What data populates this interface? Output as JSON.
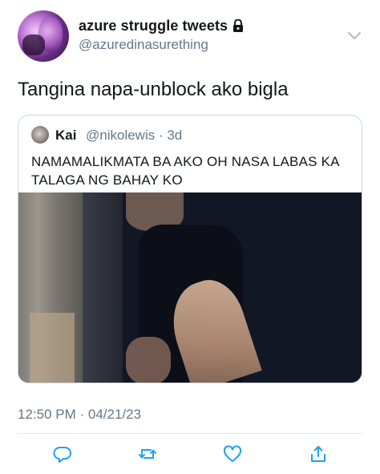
{
  "user": {
    "display_name": "azure struggle tweets",
    "handle": "@azuredinasurething",
    "protected": true
  },
  "tweet": {
    "text": "Tangina napa-unblock ako bigla",
    "timestamp": "12:50 PM · 04/21/23"
  },
  "quoted_tweet": {
    "name": "Kai",
    "handle_time": "@nikolewis · 3d",
    "text": "NAMAMALIKMATA BA AKO OH NASA LABAS KA TALAGA NG BAHAY KO"
  },
  "actions": {
    "icons": [
      "reply-icon",
      "retweet-icon",
      "like-icon",
      "share-icon"
    ]
  },
  "colors": {
    "text": "#14171a",
    "secondary": "#657786",
    "icon": "#1da1f2",
    "border": "#ccd6dd"
  }
}
